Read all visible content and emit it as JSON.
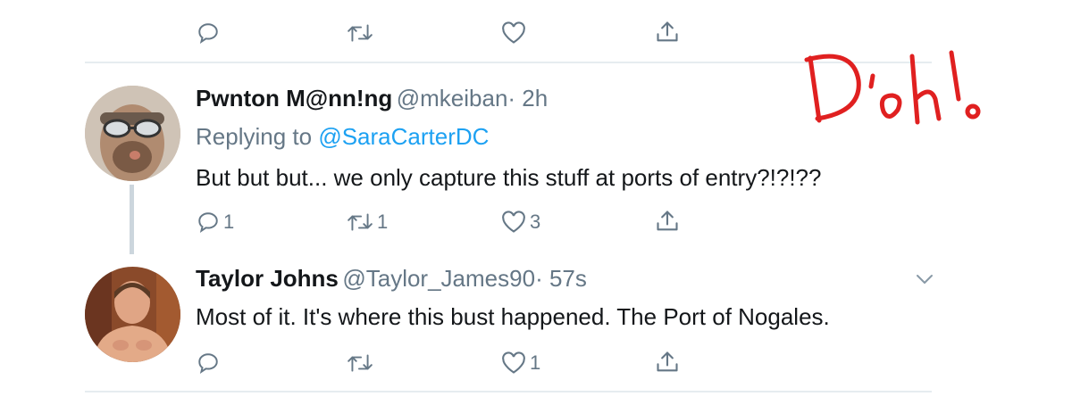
{
  "prev_tweet": {
    "actions": {
      "reply": "",
      "retweet": "",
      "like": ""
    }
  },
  "tweet1": {
    "name": "Pwnton M@nn!ng",
    "handle": "@mkeiban",
    "time": "· 2h",
    "replying_prefix": "Replying to ",
    "replying_to": "@SaraCarterDC",
    "text": "But but but... we only capture this stuff at ports of entry?!?!??",
    "counts": {
      "reply": "1",
      "retweet": "1",
      "like": "3"
    }
  },
  "tweet2": {
    "name": "Taylor Johns",
    "handle": "@Taylor_James90",
    "time": "· 57s",
    "text": "Most of it. It's where this bust happened. The Port of Nogales.",
    "counts": {
      "reply": "",
      "retweet": "",
      "like": "1"
    }
  },
  "annotation": {
    "text": "D'oh!",
    "color": "#e02020"
  },
  "colors": {
    "icon": "#657786",
    "link": "#1da1f2",
    "divider": "#e6ecf0"
  },
  "icons": [
    "reply-icon",
    "retweet-icon",
    "like-icon",
    "share-icon",
    "chevron-down-icon"
  ]
}
